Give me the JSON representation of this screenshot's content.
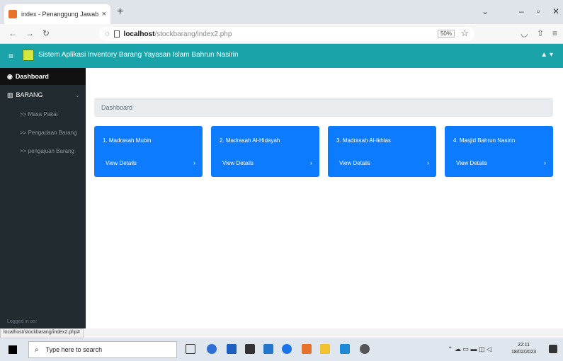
{
  "browser": {
    "tab_title": "index - Penanggung Jawab",
    "tab_close": "×",
    "new_tab": "+",
    "url_host": "localhost",
    "url_path": "/stockbarang/index2.php",
    "zoom": "50%"
  },
  "header": {
    "title": "Sistem Aplikasi Inventory Barang Yayasan Islam Bahrun Nasirin",
    "user_icon": "▲ ▾"
  },
  "sidebar": {
    "dashboard": "Dashboard",
    "group": "BARANG",
    "items": [
      ">> Masa Pakai",
      ">> Pengadaan Barang",
      ">> pengajuan Barang"
    ],
    "footer": "Logged in as:"
  },
  "main": {
    "breadcrumb": "Dashboard",
    "cards": [
      {
        "title": "1. Madrasah Mubin",
        "link": "View Details",
        "arrow": "›"
      },
      {
        "title": "2. Madrasah Al-Hidayah",
        "link": "View Details",
        "arrow": "›"
      },
      {
        "title": "3. Madrasah Al-Ikhlas",
        "link": "View Details",
        "arrow": "›"
      },
      {
        "title": "4. Masjid Bahrun Nasirin",
        "link": "View Details",
        "arrow": "›"
      }
    ]
  },
  "status_url": "localhost/stockbarang/index2.php#",
  "taskbar": {
    "search_placeholder": "Type here to search",
    "time": "22:11",
    "date": "18/02/2023"
  },
  "colors": {
    "header": "#1aa3a8",
    "card": "#0d7bff",
    "sidebar": "#222b30"
  }
}
